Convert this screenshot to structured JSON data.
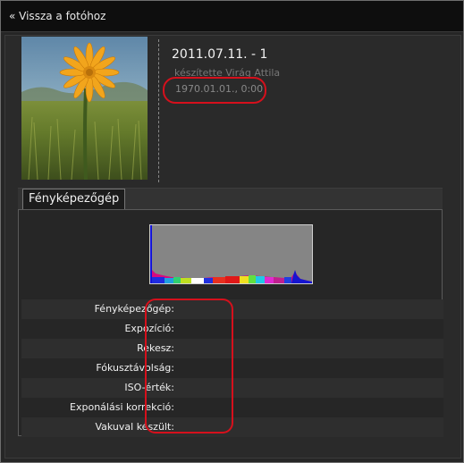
{
  "nav": {
    "back_label": "« Vissza a fotóhoz"
  },
  "photo": {
    "title": "2011.07.11. - 1",
    "author": "készítette Virág Attila",
    "date": "1970.01.01., 0:00"
  },
  "tabs": [
    {
      "label": "Fényképezőgép"
    }
  ],
  "colors": {
    "annotation": "#d6101c",
    "background": "#262626"
  },
  "exif": {
    "rows": [
      {
        "label": "Fényképezőgép:",
        "value": "-"
      },
      {
        "label": "Expozíció:",
        "value": "-"
      },
      {
        "label": "Rekesz:",
        "value": "-"
      },
      {
        "label": "Fókusztávolság:",
        "value": "-"
      },
      {
        "label": "ISO-érték:",
        "value": "-"
      },
      {
        "label": "Exponálási korrekció:",
        "value": "-"
      },
      {
        "label": "Vakuval készült:",
        "value": "-"
      }
    ]
  }
}
